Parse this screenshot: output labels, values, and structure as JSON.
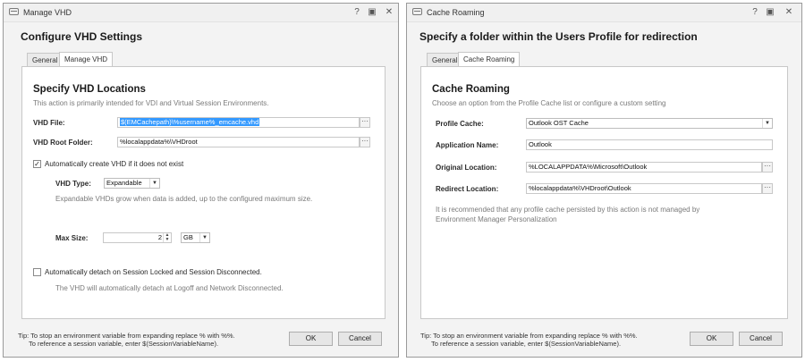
{
  "win1": {
    "title": "Manage VHD",
    "heading": "Configure VHD Settings",
    "tabs": [
      {
        "label": "General"
      },
      {
        "label": "Manage VHD"
      }
    ],
    "section_title": "Specify VHD Locations",
    "section_desc": "This action is primarily intended for VDI and Virtual Session Environments.",
    "vhd_file": {
      "label": "VHD File:",
      "value": "$(EMCachepath)\\%username%_emcache.vhd"
    },
    "vhd_root": {
      "label": "VHD Root Folder:",
      "value": "%localappdata%\\VHDroot"
    },
    "auto_create": {
      "label": "Automatically create VHD if it does not exist",
      "checked": true
    },
    "vhd_type": {
      "label": "VHD Type:",
      "value": "Expandable"
    },
    "expand_hint": "Expandable VHDs grow when data is added, up to the configured maximum size.",
    "max_size": {
      "label": "Max Size:",
      "value": "2",
      "unit": "GB"
    },
    "auto_detach": {
      "label": "Automatically detach on Session Locked and Session Disconnected.",
      "checked": false
    },
    "detach_hint": "The VHD will automatically detach at Logoff and Network Disconnected.",
    "tip_line1": "Tip: To stop an environment variable from expanding replace % with %%.",
    "tip_line2": "To reference a session variable, enter $(SessionVariableName).",
    "ok": "OK",
    "cancel": "Cancel"
  },
  "win2": {
    "title": "Cache Roaming",
    "heading": "Specify a folder within the Users Profile for redirection",
    "tabs": [
      {
        "label": "General"
      },
      {
        "label": "Cache Roaming"
      }
    ],
    "section_title": "Cache Roaming",
    "section_desc": "Choose an option from the Profile Cache list or configure a custom setting",
    "profile_cache": {
      "label": "Profile Cache:",
      "value": "Outlook OST Cache"
    },
    "app_name": {
      "label": "Application Name:",
      "value": "Outlook"
    },
    "orig_loc": {
      "label": "Original Location:",
      "value": "%LOCALAPPDATA%\\Microsoft\\Outlook"
    },
    "redir_loc": {
      "label": "Redirect Location:",
      "value": "%localappdata%\\VHDroot\\Outlook"
    },
    "note": "It is recommended that any profile cache persisted by this action is not managed by",
    "note2": "Environment Manager Personalization",
    "tip_line1": "Tip: To stop an environment variable from expanding replace % with %%.",
    "tip_line2": "To reference a session variable, enter $(SessionVariableName).",
    "ok": "OK",
    "cancel": "Cancel"
  },
  "icons": {
    "help": "?",
    "maximize": "▣",
    "close": "✕",
    "ellipsis": "···",
    "dropdown": "▼",
    "check": "✓"
  }
}
